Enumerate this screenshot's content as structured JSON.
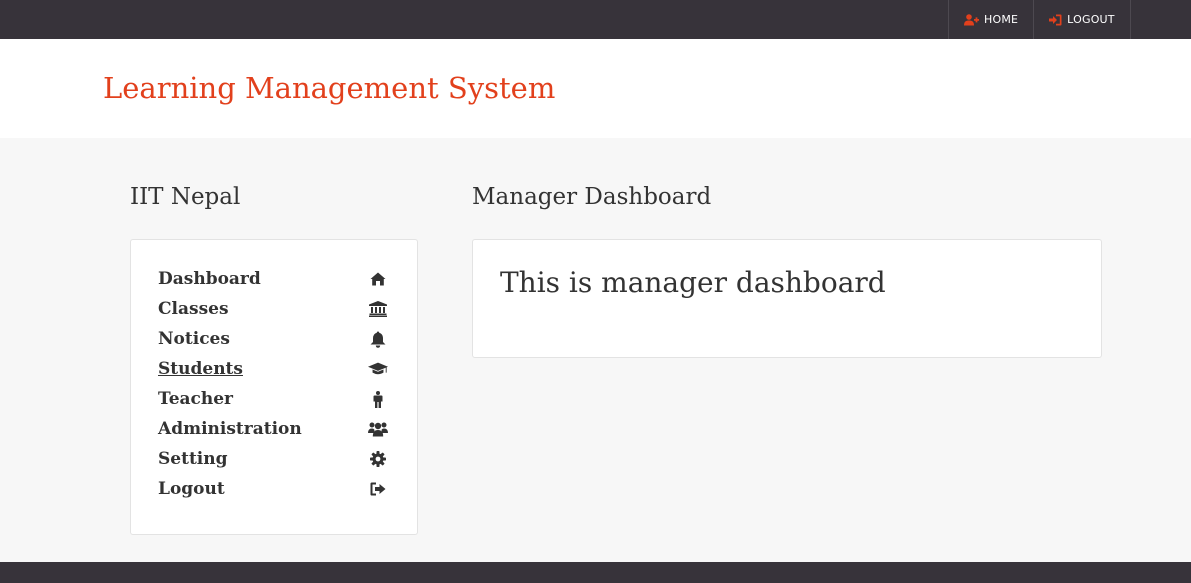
{
  "topnav": {
    "home_label": "HOME",
    "logout_label": "LOGOUT"
  },
  "header": {
    "title": "Learning Management System"
  },
  "sidebar": {
    "title": "IIT Nepal",
    "items": [
      {
        "label": "Dashboard",
        "icon": "home-icon"
      },
      {
        "label": "Classes",
        "icon": "institution-icon"
      },
      {
        "label": "Notices",
        "icon": "bell-icon"
      },
      {
        "label": "Students",
        "icon": "graduation-cap-icon"
      },
      {
        "label": "Teacher",
        "icon": "person-icon"
      },
      {
        "label": "Administration",
        "icon": "users-icon"
      },
      {
        "label": "Setting",
        "icon": "gear-icon"
      },
      {
        "label": "Logout",
        "icon": "sign-out-icon"
      }
    ]
  },
  "main": {
    "title": "Manager Dashboard",
    "content": "This is manager dashboard"
  },
  "colors": {
    "accent": "#e2401c",
    "topbar": "#37333a",
    "background": "#f7f7f7"
  }
}
